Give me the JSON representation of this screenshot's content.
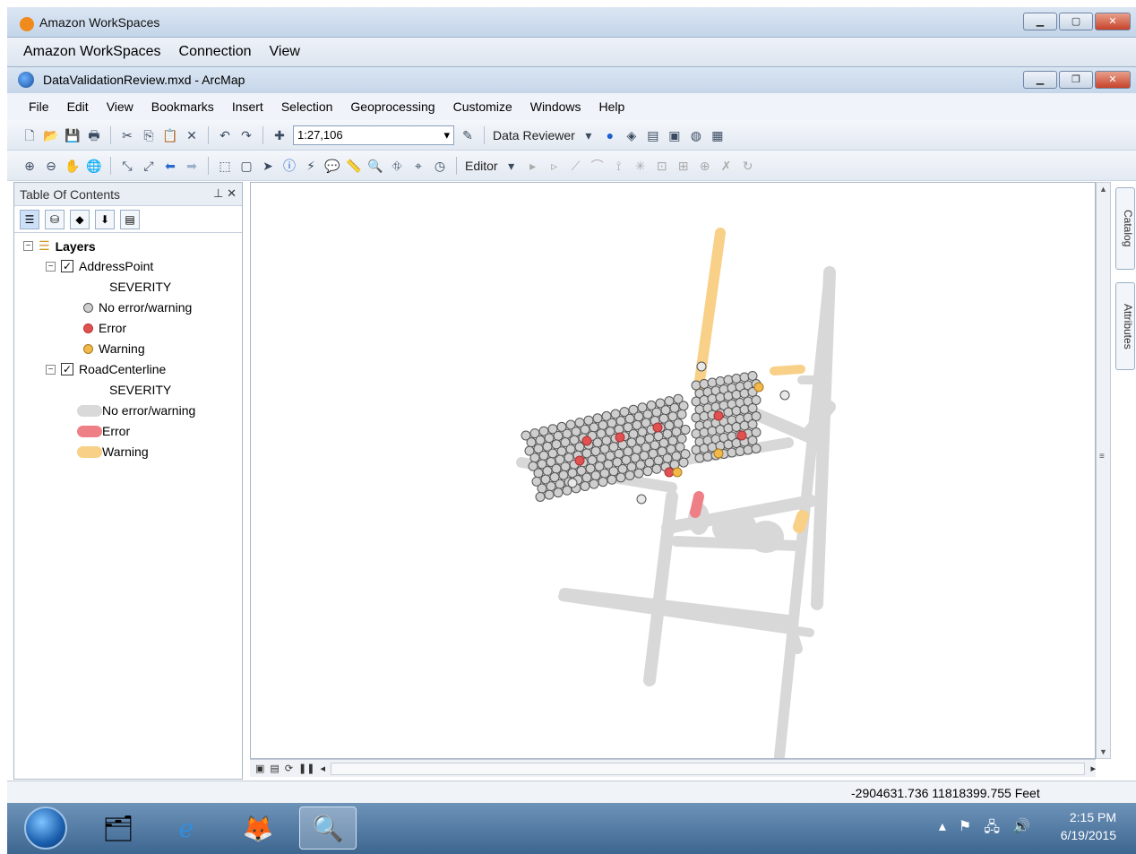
{
  "workspaces": {
    "title": "Amazon WorkSpaces",
    "menu": [
      "Amazon WorkSpaces",
      "Connection",
      "View"
    ]
  },
  "arcmap": {
    "title": "DataValidationReview.mxd - ArcMap",
    "menu": [
      "File",
      "Edit",
      "View",
      "Bookmarks",
      "Insert",
      "Selection",
      "Geoprocessing",
      "Customize",
      "Windows",
      "Help"
    ]
  },
  "toolbar": {
    "scale": "1:27,106",
    "data_reviewer": "Data Reviewer",
    "editor": "Editor"
  },
  "toc": {
    "title": "Table Of Contents",
    "root": "Layers",
    "layers": [
      {
        "name": "AddressPoint",
        "field": "SEVERITY",
        "classes": [
          {
            "label": "No error/warning",
            "color": "#cfcfcf"
          },
          {
            "label": "Error",
            "color": "#e05252"
          },
          {
            "label": "Warning",
            "color": "#f2b84b"
          }
        ]
      },
      {
        "name": "RoadCenterline",
        "field": "SEVERITY",
        "classes": [
          {
            "label": "No error/warning",
            "color": "#d9d9d9"
          },
          {
            "label": "Error",
            "color": "#ef7f86"
          },
          {
            "label": "Warning",
            "color": "#f8d087"
          }
        ]
      }
    ]
  },
  "side_tabs": [
    "Catalog",
    "Attributes"
  ],
  "status": {
    "coordinates": "-2904631.736  11818399.755 Feet"
  },
  "taskbar": {
    "time": "2:15 PM",
    "date": "6/19/2015"
  }
}
